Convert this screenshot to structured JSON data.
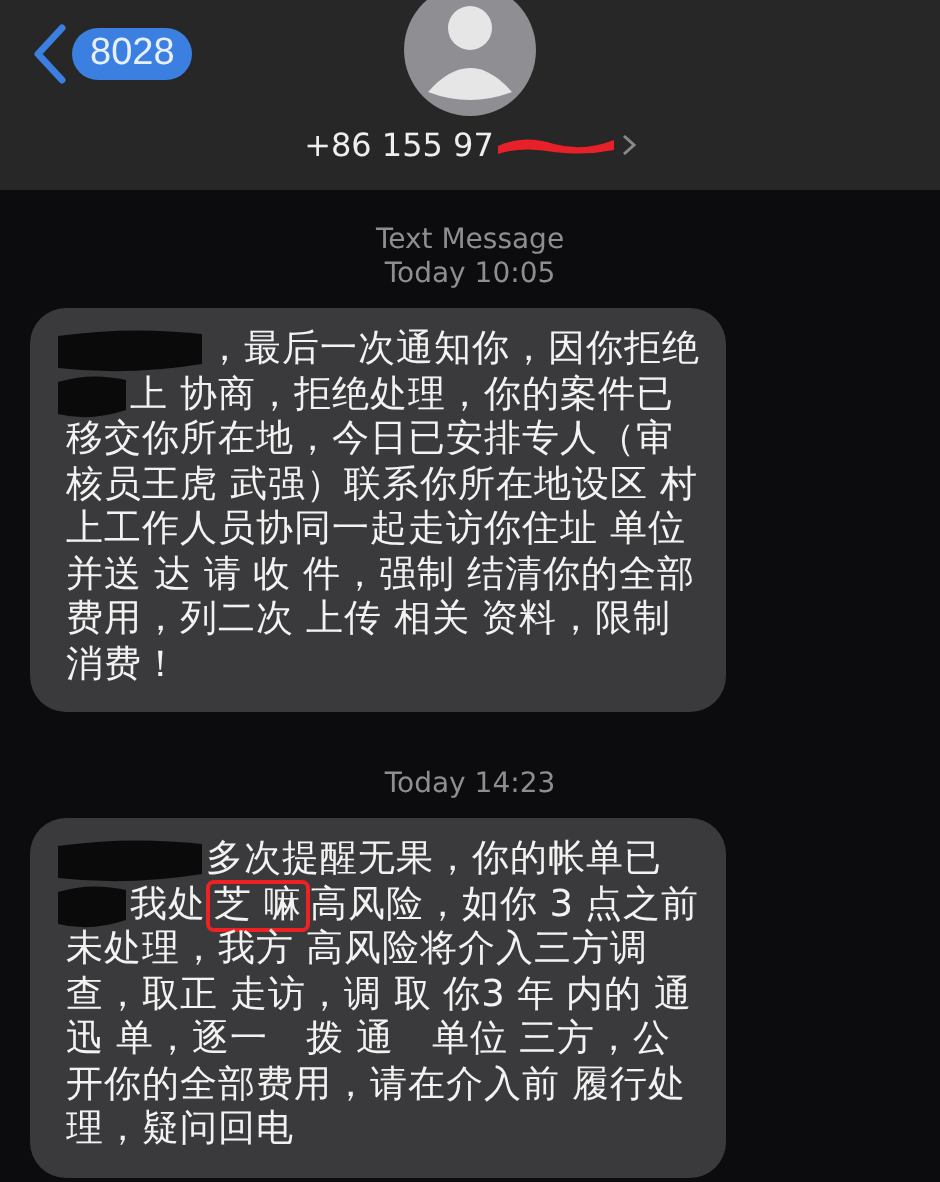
{
  "header": {
    "back_label": "8028",
    "phone": {
      "text": "+86 155 97",
      "redacted": true
    }
  },
  "messages": [
    {
      "service": "Text Message",
      "time": "Today 10:05",
      "lines": [
        {
          "segments": [
            {
              "kind": "redacted"
            },
            {
              "kind": "text",
              "text": "，最后一次通知你，因你拒绝",
              "highlighted": false
            }
          ]
        },
        {
          "segments": [
            {
              "kind": "redacted"
            },
            {
              "kind": "text",
              "text": "上 协商，拒绝处理，你的案件已",
              "highlighted": false
            }
          ]
        },
        {
          "segments": [
            {
              "kind": "text",
              "text": "移交你所在地，今日已安排专人（审",
              "highlighted": false
            }
          ]
        },
        {
          "segments": [
            {
              "kind": "text",
              "text": "核员王虎 武强）联系你所在地设区 村",
              "highlighted": false
            }
          ]
        },
        {
          "segments": [
            {
              "kind": "text",
              "text": "上工作人员协同一起走访你住址 单位",
              "highlighted": false
            }
          ]
        },
        {
          "segments": [
            {
              "kind": "text",
              "text": "并送 达 请 收 件，强制 结清你的全部",
              "highlighted": false
            }
          ]
        },
        {
          "segments": [
            {
              "kind": "text",
              "text": "费用，列二次 上传 相关 资料，限制",
              "highlighted": false
            }
          ]
        },
        {
          "segments": [
            {
              "kind": "text",
              "text": "消费！",
              "highlighted": false
            }
          ]
        }
      ]
    },
    {
      "time": "Today 14:23",
      "lines": [
        {
          "segments": [
            {
              "kind": "redacted"
            },
            {
              "kind": "text",
              "text": "多次提醒无果，你的帐单已",
              "highlighted": false
            }
          ]
        },
        {
          "segments": [
            {
              "kind": "redacted"
            },
            {
              "kind": "text",
              "text": "我处",
              "highlighted": false
            },
            {
              "kind": "text",
              "text": "芝 嘛",
              "highlighted": true
            },
            {
              "kind": "text",
              "text": "高风险，如你 3 点之前",
              "highlighted": false
            }
          ]
        },
        {
          "segments": [
            {
              "kind": "text",
              "text": "未处理，我方 高风险将介入三方调",
              "highlighted": false
            }
          ]
        },
        {
          "segments": [
            {
              "kind": "text",
              "text": "查，取正 走访，调 取 你3 年 内的 通",
              "highlighted": false
            }
          ]
        },
        {
          "segments": [
            {
              "kind": "text",
              "text": "迅 单，逐一　拨 通　单位 三方，公",
              "highlighted": false
            }
          ]
        },
        {
          "segments": [
            {
              "kind": "text",
              "text": "开你的全部费用，请在介入前 履行处",
              "highlighted": false
            }
          ]
        },
        {
          "segments": [
            {
              "kind": "text",
              "text": "理，疑问回电",
              "highlighted": false
            }
          ]
        }
      ]
    }
  ]
}
